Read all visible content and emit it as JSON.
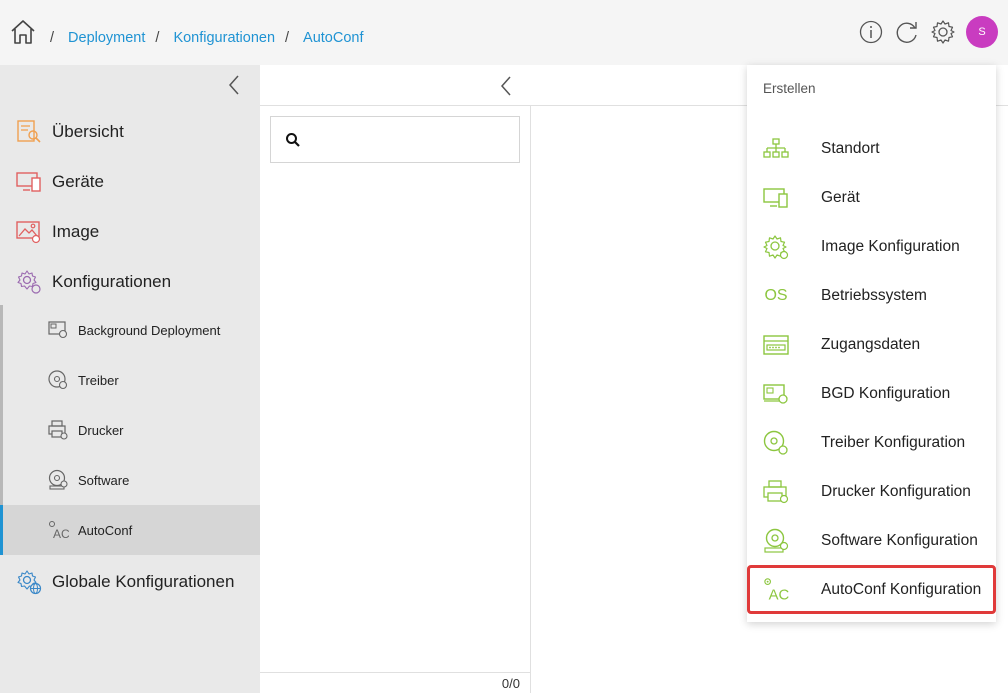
{
  "header": {
    "breadcrumbs": [
      "Deployment",
      "Konfigurationen",
      "AutoConf"
    ],
    "separator": "/",
    "avatar_initial": "S"
  },
  "sidebar": {
    "items": [
      {
        "label": "Übersicht",
        "icon": "overview-icon"
      },
      {
        "label": "Geräte",
        "icon": "devices-icon"
      },
      {
        "label": "Image",
        "icon": "image-icon"
      },
      {
        "label": "Konfigurationen",
        "icon": "config-gears-icon"
      }
    ],
    "sub_items": [
      {
        "label": "Background Deployment",
        "icon": "background-deployment-icon"
      },
      {
        "label": "Treiber",
        "icon": "driver-disc-icon"
      },
      {
        "label": "Drucker",
        "icon": "printer-icon"
      },
      {
        "label": "Software",
        "icon": "software-disc-icon"
      },
      {
        "label": "AutoConf",
        "icon": "autoconf-icon",
        "active": true
      }
    ],
    "global": {
      "label": "Globale Konfigurationen",
      "icon": "globe-gear-icon"
    }
  },
  "list": {
    "search_placeholder": "",
    "count": "0/0"
  },
  "menu": {
    "header": "Erstellen",
    "items": [
      {
        "label": "Standort",
        "icon": "org-chart-icon"
      },
      {
        "label": "Gerät",
        "icon": "device-icon"
      },
      {
        "label": "Image Konfiguration",
        "icon": "image-config-gear-icon"
      },
      {
        "label": "Betriebssystem",
        "icon": "os-icon",
        "icon_text": "OS"
      },
      {
        "label": "Zugangsdaten",
        "icon": "credentials-icon"
      },
      {
        "label": "BGD Konfiguration",
        "icon": "bgd-config-icon"
      },
      {
        "label": "Treiber Konfiguration",
        "icon": "driver-config-icon"
      },
      {
        "label": "Drucker Konfiguration",
        "icon": "printer-config-icon"
      },
      {
        "label": "Software Konfiguration",
        "icon": "software-config-icon"
      },
      {
        "label": "AutoConf Konfiguration",
        "icon": "autoconf-config-icon",
        "icon_text": "AC",
        "highlighted": true
      }
    ]
  },
  "colors": {
    "accent": "#1f93d3",
    "icon_green": "#8cc63f",
    "highlight_red": "#e03a3a",
    "avatar": "#c93cc0",
    "orange_icon": "#f0a050",
    "red_icon": "#e06060",
    "purple_icon": "#9b6bb0"
  }
}
